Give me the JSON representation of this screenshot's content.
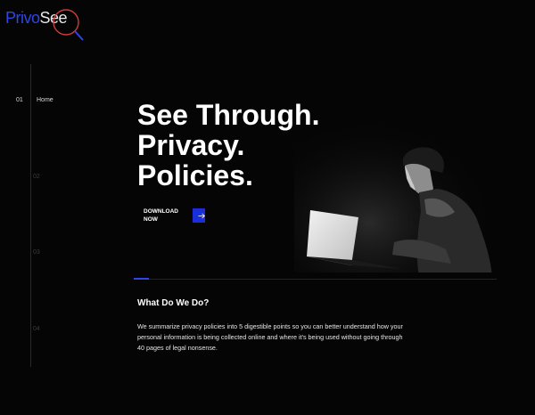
{
  "brand": {
    "name_part1": "Privo",
    "name_part2": "See"
  },
  "nav": {
    "items": [
      {
        "number": "01",
        "label": "Home"
      },
      {
        "number": "02",
        "label": ""
      },
      {
        "number": "03",
        "label": ""
      },
      {
        "number": "04",
        "label": ""
      }
    ],
    "active_index": 0
  },
  "hero": {
    "headline": [
      "See Through.",
      "Privacy.",
      "Policies."
    ],
    "cta_label": "DOWNLOAD NOW",
    "image": "person-at-laptop-in-dark"
  },
  "section": {
    "title": "What Do We Do?",
    "body": "We summarize privacy policies into 5 digestible points so you can better understand how your personal information is being collected online and where it's being used without going through 40 pages of legal nonsense."
  },
  "colors": {
    "accent": "#2f45e6",
    "button": "#1a2fd9",
    "background": "#050505"
  }
}
